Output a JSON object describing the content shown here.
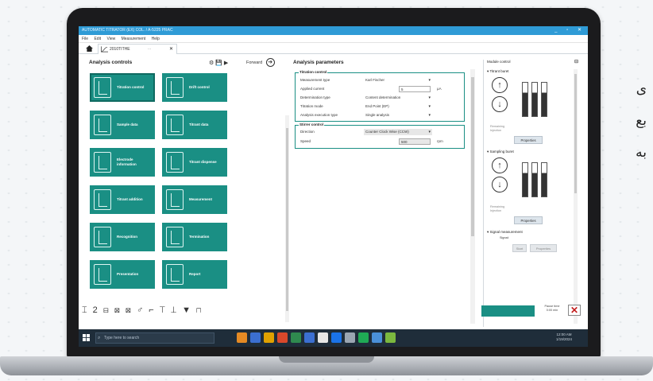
{
  "window": {
    "title": "AUTOMATIC TITRATOR (EX) COL. / A-5225 PRAC",
    "controls": "_ ▫ ✕"
  },
  "menu": [
    "File",
    "Edit",
    "View",
    "Measurement",
    "Help"
  ],
  "tab": {
    "label": "2010TITHE",
    "dots": "∙∙∙",
    "close": "✕"
  },
  "left_panel": {
    "title": "Analysis controls",
    "tools": "⚙ 💾 ▶",
    "forward": "Forward",
    "forward_icon": "arrow-right-circle-icon",
    "tiles": [
      {
        "label": "Titration control",
        "icon": "titration-icon"
      },
      {
        "label": "Drift control",
        "icon": "drift-curve-icon"
      },
      {
        "label": "Sample data",
        "icon": "sample-icon"
      },
      {
        "label": "Titrant data",
        "icon": "titrant-bottle-icon"
      },
      {
        "label": "Electrode information",
        "icon": "electrode-icon"
      },
      {
        "label": "Titrant dispense",
        "icon": "dispense-icon"
      },
      {
        "label": "Titrant addition",
        "icon": "addition-icon"
      },
      {
        "label": "Measurement",
        "icon": "measurement-curve-icon"
      },
      {
        "label": "Recognition",
        "icon": "recognition-icon"
      },
      {
        "label": "Termination",
        "icon": "termination-icon"
      },
      {
        "label": "Presentation",
        "icon": "presentation-icon"
      },
      {
        "label": "Report",
        "icon": "report-icon"
      }
    ]
  },
  "mid_panel": {
    "title": "Analysis parameters",
    "group1_title": "Titration control",
    "rows1": [
      {
        "label": "Measurement type",
        "value": "Karl Fischer"
      },
      {
        "label": "Applied current",
        "value": "5",
        "unit": "µA"
      },
      {
        "label": "Determination type",
        "value": "Content determination"
      },
      {
        "label": "Titration mode",
        "value": "End Point (EP)"
      },
      {
        "label": "Analysis execution type",
        "value": "Single analysis"
      }
    ],
    "group2_title": "Stirrer control",
    "rows2": [
      {
        "label": "Direction",
        "value": "Counter Clock Wise (CCW)"
      },
      {
        "label": "Speed",
        "value": "500",
        "unit": "rpm"
      }
    ]
  },
  "right_panel": {
    "title": "Module control",
    "pin": "⊟",
    "titrant_burette": "Titrant buret",
    "sampling_burette": "Sampling buret",
    "signal_measurement": "Signal measurement",
    "remaining": "Remaining",
    "injection": "Injection",
    "properties": "Properties",
    "signal": "Signal:",
    "start": "Start",
    "btn2": "Properties"
  },
  "bottom_tools": "⌶ 2 ⊟ ⊠ ⊠ ♂ ⌐ ⊤ ⊥ ▼ ⊓",
  "bottom_status": {
    "pause": "Pause time",
    "pause_val": "0:00 min",
    "stop": "✕"
  },
  "taskbar": {
    "search": "Type here to search",
    "time": "12:00 AM",
    "date": "1/19/2024",
    "colors": [
      "#e58a24",
      "#3b6fd1",
      "#e0a100",
      "#d9482b",
      "#2f8a4f",
      "#3b6fd1",
      "#e6e6e6",
      "#1a73e8",
      "#9aa6b2",
      "#1faa55",
      "#4a90d9",
      "#7bb83f"
    ]
  },
  "rtl_lines": [
    "ی",
    "بع",
    "به"
  ]
}
